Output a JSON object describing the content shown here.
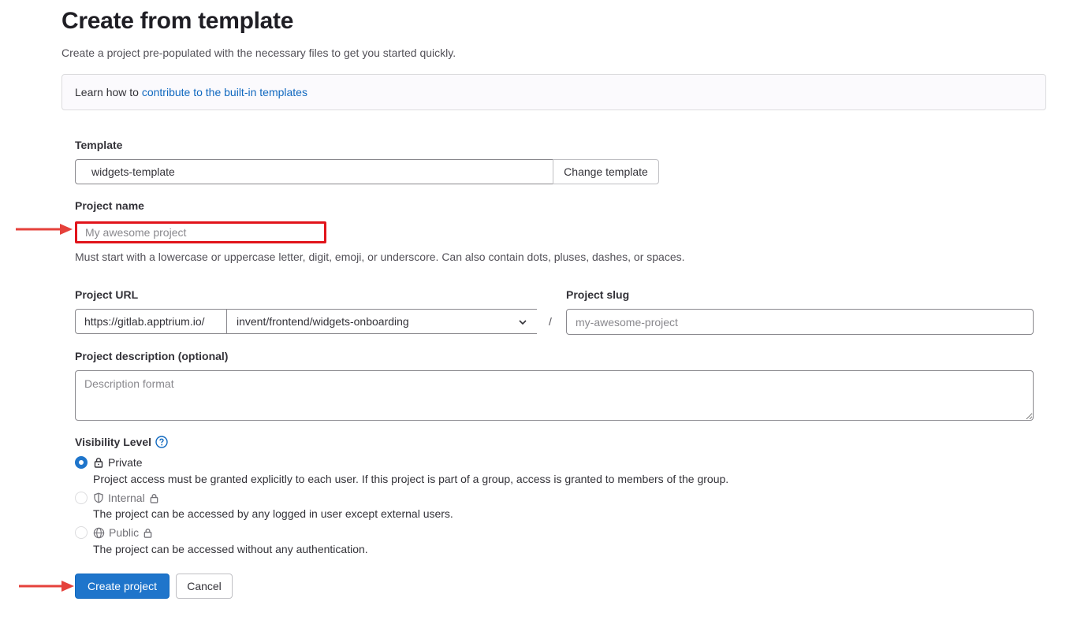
{
  "header": {
    "title": "Create from template",
    "subtitle": "Create a project pre-populated with the necessary files to get you started quickly."
  },
  "info": {
    "prefix": "Learn how to ",
    "link": "contribute to the built-in templates"
  },
  "template": {
    "label": "Template",
    "value": "widgets-template",
    "change_button": "Change template"
  },
  "project_name": {
    "label": "Project name",
    "placeholder": "My awesome project",
    "help": "Must start with a lowercase or uppercase letter, digit, emoji, or underscore. Can also contain dots, pluses, dashes, or spaces."
  },
  "project_url": {
    "label": "Project URL",
    "prefix": "https://gitlab.apptrium.io/",
    "namespace": "invent/frontend/widgets-onboarding",
    "separator": "/"
  },
  "project_slug": {
    "label": "Project slug",
    "placeholder": "my-awesome-project"
  },
  "description": {
    "label": "Project description (optional)",
    "placeholder": "Description format"
  },
  "visibility": {
    "label": "Visibility Level",
    "options": [
      {
        "name": "Private",
        "description": "Project access must be granted explicitly to each user. If this project is part of a group, access is granted to members of the group.",
        "checked": true,
        "disabled": false
      },
      {
        "name": "Internal",
        "description": "The project can be accessed by any logged in user except external users.",
        "checked": false,
        "disabled": true
      },
      {
        "name": "Public",
        "description": "The project can be accessed without any authentication.",
        "checked": false,
        "disabled": true
      }
    ]
  },
  "actions": {
    "create": "Create project",
    "cancel": "Cancel"
  },
  "colors": {
    "primary": "#1f75cb",
    "link": "#1068bf",
    "highlight": "#e1141b",
    "annotation_arrow": "#e5413b"
  }
}
